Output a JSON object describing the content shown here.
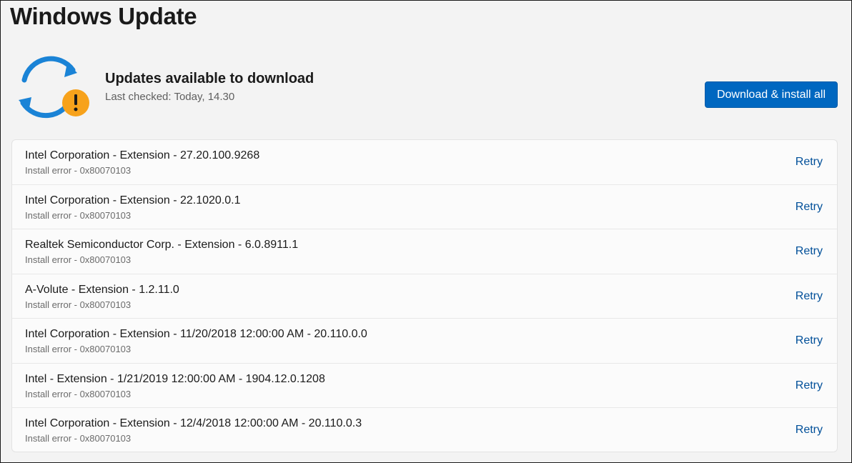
{
  "page": {
    "title": "Windows Update"
  },
  "status": {
    "icon": "sync-warning-icon",
    "title": "Updates available to download",
    "last_checked": "Last checked: Today, 14.30"
  },
  "actions": {
    "download_install_label": "Download & install all"
  },
  "colors": {
    "accent": "#0067c0",
    "warning": "#f7a21b",
    "sync_blue": "#1a83d6",
    "link": "#004f99"
  },
  "updates": [
    {
      "name": "Intel Corporation - Extension - 27.20.100.9268",
      "error": "Install error - 0x80070103",
      "action": "Retry"
    },
    {
      "name": "Intel Corporation - Extension - 22.1020.0.1",
      "error": "Install error - 0x80070103",
      "action": "Retry"
    },
    {
      "name": "Realtek Semiconductor Corp. - Extension - 6.0.8911.1",
      "error": "Install error - 0x80070103",
      "action": "Retry"
    },
    {
      "name": "A-Volute - Extension - 1.2.11.0",
      "error": "Install error - 0x80070103",
      "action": "Retry"
    },
    {
      "name": "Intel Corporation - Extension - 11/20/2018 12:00:00 AM - 20.110.0.0",
      "error": "Install error - 0x80070103",
      "action": "Retry"
    },
    {
      "name": "Intel - Extension - 1/21/2019 12:00:00 AM - 1904.12.0.1208",
      "error": "Install error - 0x80070103",
      "action": "Retry"
    },
    {
      "name": "Intel Corporation - Extension - 12/4/2018 12:00:00 AM - 20.110.0.3",
      "error": "Install error - 0x80070103",
      "action": "Retry"
    }
  ]
}
